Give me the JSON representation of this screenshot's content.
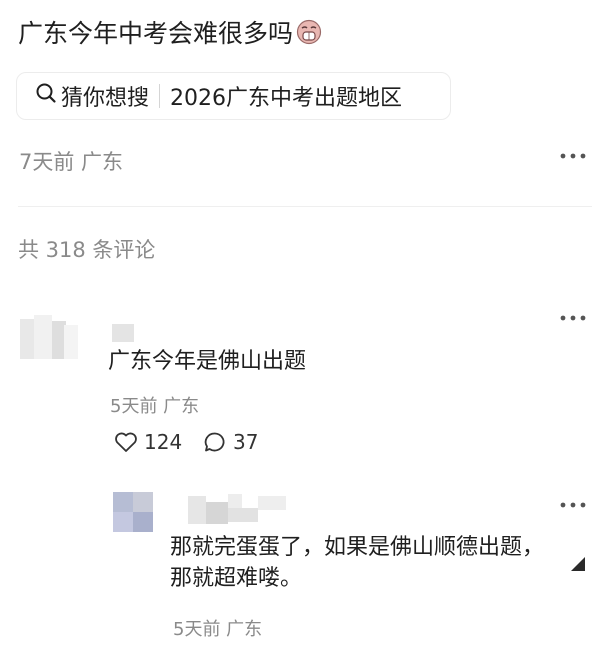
{
  "post": {
    "title": "广东今年中考会难很多吗",
    "title_emoji": "weary-face-emoji",
    "search": {
      "icon": "search-icon",
      "prefix": "猜你想搜",
      "query": "2026广东中考出题地区"
    },
    "time_location": "7天前 广东",
    "more_icon": "more-icon"
  },
  "comments_header": {
    "count_text": "共 318 条评论"
  },
  "comments": [
    {
      "text": "广东今年是佛山出题",
      "time_location": "5天前 广东",
      "likes": "124",
      "replies": "37"
    }
  ],
  "reply": {
    "text_line1": "那就完蛋蛋了，如果是佛山顺德出题，",
    "text_line2": "那就超难喽。",
    "time_location": "5天前 广东"
  },
  "colors": {
    "text": "#1f1f1f",
    "meta": "#8a8a8a",
    "divider": "#efefef"
  }
}
